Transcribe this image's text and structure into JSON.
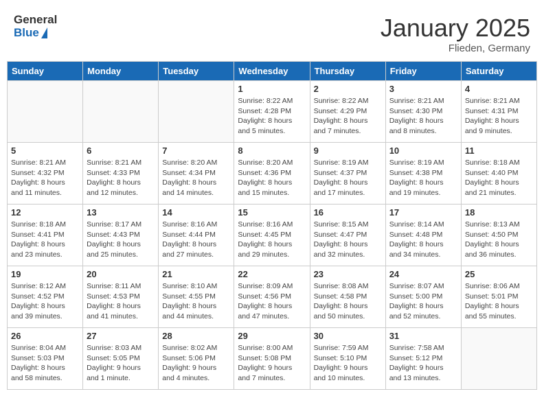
{
  "header": {
    "logo_general": "General",
    "logo_blue": "Blue",
    "month_title": "January 2025",
    "location": "Flieden, Germany"
  },
  "days_of_week": [
    "Sunday",
    "Monday",
    "Tuesday",
    "Wednesday",
    "Thursday",
    "Friday",
    "Saturday"
  ],
  "weeks": [
    [
      {
        "day": "",
        "info": ""
      },
      {
        "day": "",
        "info": ""
      },
      {
        "day": "",
        "info": ""
      },
      {
        "day": "1",
        "info": "Sunrise: 8:22 AM\nSunset: 4:28 PM\nDaylight: 8 hours\nand 5 minutes."
      },
      {
        "day": "2",
        "info": "Sunrise: 8:22 AM\nSunset: 4:29 PM\nDaylight: 8 hours\nand 7 minutes."
      },
      {
        "day": "3",
        "info": "Sunrise: 8:21 AM\nSunset: 4:30 PM\nDaylight: 8 hours\nand 8 minutes."
      },
      {
        "day": "4",
        "info": "Sunrise: 8:21 AM\nSunset: 4:31 PM\nDaylight: 8 hours\nand 9 minutes."
      }
    ],
    [
      {
        "day": "5",
        "info": "Sunrise: 8:21 AM\nSunset: 4:32 PM\nDaylight: 8 hours\nand 11 minutes."
      },
      {
        "day": "6",
        "info": "Sunrise: 8:21 AM\nSunset: 4:33 PM\nDaylight: 8 hours\nand 12 minutes."
      },
      {
        "day": "7",
        "info": "Sunrise: 8:20 AM\nSunset: 4:34 PM\nDaylight: 8 hours\nand 14 minutes."
      },
      {
        "day": "8",
        "info": "Sunrise: 8:20 AM\nSunset: 4:36 PM\nDaylight: 8 hours\nand 15 minutes."
      },
      {
        "day": "9",
        "info": "Sunrise: 8:19 AM\nSunset: 4:37 PM\nDaylight: 8 hours\nand 17 minutes."
      },
      {
        "day": "10",
        "info": "Sunrise: 8:19 AM\nSunset: 4:38 PM\nDaylight: 8 hours\nand 19 minutes."
      },
      {
        "day": "11",
        "info": "Sunrise: 8:18 AM\nSunset: 4:40 PM\nDaylight: 8 hours\nand 21 minutes."
      }
    ],
    [
      {
        "day": "12",
        "info": "Sunrise: 8:18 AM\nSunset: 4:41 PM\nDaylight: 8 hours\nand 23 minutes."
      },
      {
        "day": "13",
        "info": "Sunrise: 8:17 AM\nSunset: 4:43 PM\nDaylight: 8 hours\nand 25 minutes."
      },
      {
        "day": "14",
        "info": "Sunrise: 8:16 AM\nSunset: 4:44 PM\nDaylight: 8 hours\nand 27 minutes."
      },
      {
        "day": "15",
        "info": "Sunrise: 8:16 AM\nSunset: 4:45 PM\nDaylight: 8 hours\nand 29 minutes."
      },
      {
        "day": "16",
        "info": "Sunrise: 8:15 AM\nSunset: 4:47 PM\nDaylight: 8 hours\nand 32 minutes."
      },
      {
        "day": "17",
        "info": "Sunrise: 8:14 AM\nSunset: 4:48 PM\nDaylight: 8 hours\nand 34 minutes."
      },
      {
        "day": "18",
        "info": "Sunrise: 8:13 AM\nSunset: 4:50 PM\nDaylight: 8 hours\nand 36 minutes."
      }
    ],
    [
      {
        "day": "19",
        "info": "Sunrise: 8:12 AM\nSunset: 4:52 PM\nDaylight: 8 hours\nand 39 minutes."
      },
      {
        "day": "20",
        "info": "Sunrise: 8:11 AM\nSunset: 4:53 PM\nDaylight: 8 hours\nand 41 minutes."
      },
      {
        "day": "21",
        "info": "Sunrise: 8:10 AM\nSunset: 4:55 PM\nDaylight: 8 hours\nand 44 minutes."
      },
      {
        "day": "22",
        "info": "Sunrise: 8:09 AM\nSunset: 4:56 PM\nDaylight: 8 hours\nand 47 minutes."
      },
      {
        "day": "23",
        "info": "Sunrise: 8:08 AM\nSunset: 4:58 PM\nDaylight: 8 hours\nand 50 minutes."
      },
      {
        "day": "24",
        "info": "Sunrise: 8:07 AM\nSunset: 5:00 PM\nDaylight: 8 hours\nand 52 minutes."
      },
      {
        "day": "25",
        "info": "Sunrise: 8:06 AM\nSunset: 5:01 PM\nDaylight: 8 hours\nand 55 minutes."
      }
    ],
    [
      {
        "day": "26",
        "info": "Sunrise: 8:04 AM\nSunset: 5:03 PM\nDaylight: 8 hours\nand 58 minutes."
      },
      {
        "day": "27",
        "info": "Sunrise: 8:03 AM\nSunset: 5:05 PM\nDaylight: 9 hours\nand 1 minute."
      },
      {
        "day": "28",
        "info": "Sunrise: 8:02 AM\nSunset: 5:06 PM\nDaylight: 9 hours\nand 4 minutes."
      },
      {
        "day": "29",
        "info": "Sunrise: 8:00 AM\nSunset: 5:08 PM\nDaylight: 9 hours\nand 7 minutes."
      },
      {
        "day": "30",
        "info": "Sunrise: 7:59 AM\nSunset: 5:10 PM\nDaylight: 9 hours\nand 10 minutes."
      },
      {
        "day": "31",
        "info": "Sunrise: 7:58 AM\nSunset: 5:12 PM\nDaylight: 9 hours\nand 13 minutes."
      },
      {
        "day": "",
        "info": ""
      }
    ]
  ]
}
